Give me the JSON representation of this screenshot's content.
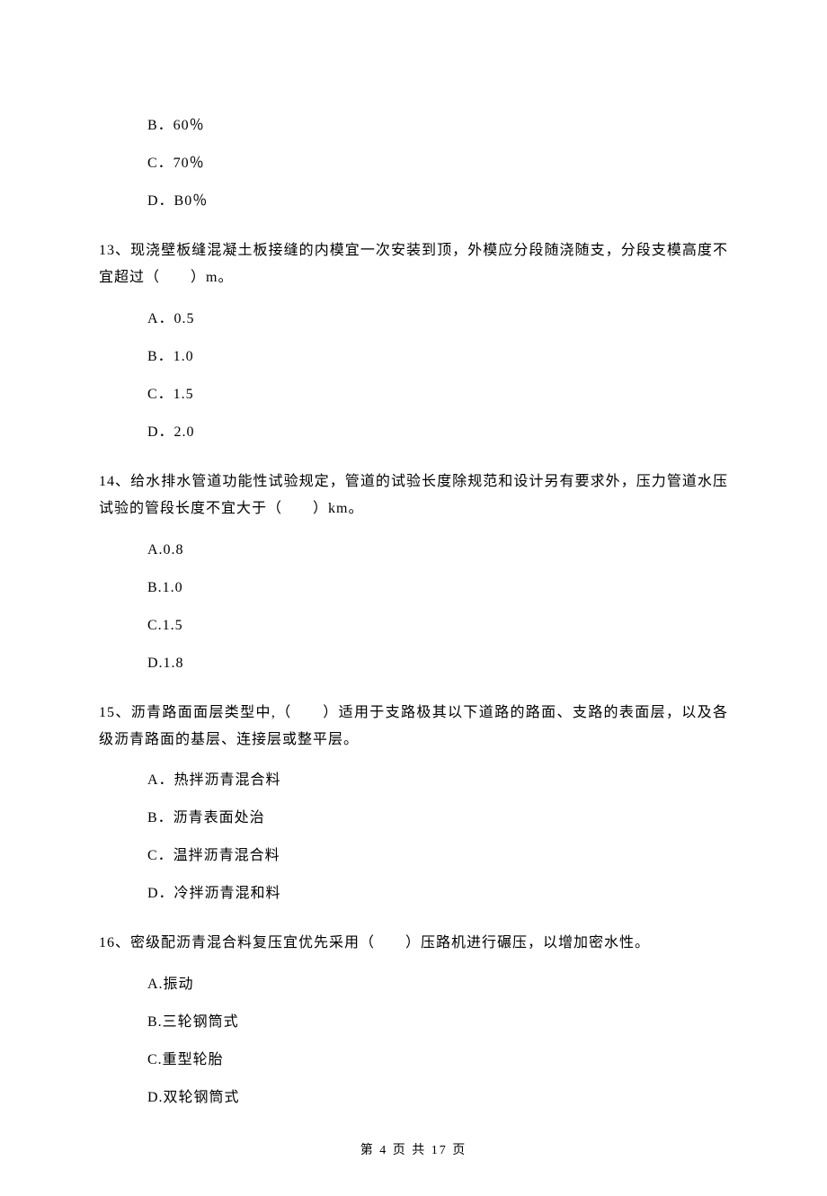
{
  "q12": {
    "options": {
      "b": "B．60％",
      "c": "C．70％",
      "d": "D．B0％"
    }
  },
  "q13": {
    "stem": "13、现浇壁板缝混凝土板接缝的内模宜一次安装到顶，外模应分段随浇随支，分段支模高度不宜超过（　　）m。",
    "options": {
      "a": "A．0.5",
      "b": "B．1.0",
      "c": "C．1.5",
      "d": "D．2.0"
    }
  },
  "q14": {
    "stem": "14、给水排水管道功能性试验规定，管道的试验长度除规范和设计另有要求外，压力管道水压试验的管段长度不宜大于（　　）km。",
    "options": {
      "a": "A.0.8",
      "b": "B.1.0",
      "c": "C.1.5",
      "d": "D.1.8"
    }
  },
  "q15": {
    "stem": "15、沥青路面面层类型中,（　　）适用于支路极其以下道路的路面、支路的表面层，以及各级沥青路面的基层、连接层或整平层。",
    "options": {
      "a": "A．热拌沥青混合料",
      "b": "B．沥青表面处治",
      "c": "C．温拌沥青混合料",
      "d": "D．冷拌沥青混和料"
    }
  },
  "q16": {
    "stem": "16、密级配沥青混合料复压宜优先采用（　　）压路机进行碾压，以增加密水性。",
    "options": {
      "a": "A.振动",
      "b": "B.三轮钢筒式",
      "c": "C.重型轮胎",
      "d": "D.双轮钢筒式"
    }
  },
  "footer": "第 4 页 共 17 页"
}
